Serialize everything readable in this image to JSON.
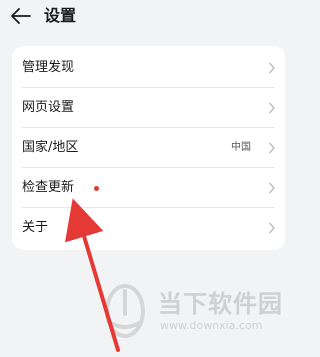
{
  "header": {
    "title": "设置",
    "back_icon": "arrow-left-icon"
  },
  "settings": [
    {
      "label": "管理发现",
      "value": "",
      "badge": false,
      "icon": "chevron-right-icon"
    },
    {
      "label": "网页设置",
      "value": "",
      "badge": false,
      "icon": "chevron-right-icon"
    },
    {
      "label": "国家/地区",
      "value": "中国",
      "badge": false,
      "icon": "chevron-right-icon"
    },
    {
      "label": "检查更新",
      "value": "",
      "badge": true,
      "badge_color": "#e53935",
      "icon": "chevron-right-icon"
    },
    {
      "label": "关于",
      "value": "",
      "badge": false,
      "icon": "chevron-right-icon"
    }
  ],
  "watermark": {
    "title": "当下软件园",
    "url": "www.downxia.com"
  },
  "annotation": {
    "arrow_color": "#e53935",
    "target": "关于"
  }
}
